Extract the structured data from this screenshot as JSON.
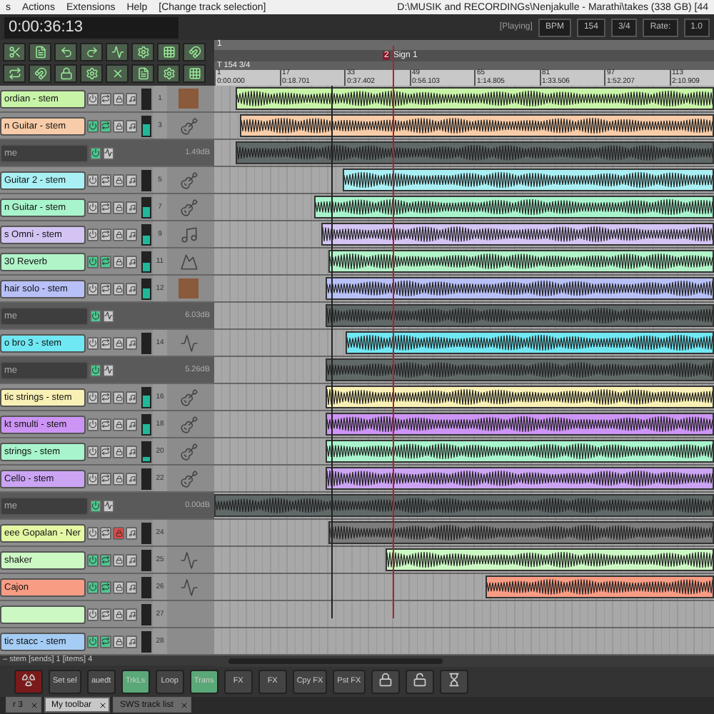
{
  "menu": [
    "s",
    "Actions",
    "Extensions",
    "Help",
    "[Change track selection]"
  ],
  "window": {
    "title": "D:\\MUSIK and RECORDINGs\\Nenjakulle - Marathi\\takes (338 GB) [44"
  },
  "transport": {
    "time": "0:00:36:13",
    "state": "[Playing]",
    "bpm_label": "BPM",
    "bpm": "154",
    "signature": "3/4",
    "rate_label": "Rate:",
    "rate": "1.0"
  },
  "ruler": {
    "marker": "1",
    "region_number": "2",
    "region": "Sign 1",
    "tempo": "T 154 3/4",
    "measures": [
      {
        "bar": "1",
        "time": "0:00.000"
      },
      {
        "bar": "17",
        "time": "0:18.701"
      },
      {
        "bar": "33",
        "time": "0:37.402"
      },
      {
        "bar": "49",
        "time": "0:56.103"
      },
      {
        "bar": "65",
        "time": "1:14.805"
      },
      {
        "bar": "81",
        "time": "1:33.506"
      },
      {
        "bar": "97",
        "time": "1:52.207"
      },
      {
        "bar": "113",
        "time": "2:10.909"
      }
    ]
  },
  "tracks": [
    {
      "kind": "track",
      "name": "ordian - stem",
      "color": "#c8f4a8",
      "number": "1",
      "fx": false,
      "muted": false
    },
    {
      "kind": "track",
      "name": "n Guitar - stem",
      "color": "#f8cca8",
      "number": "3",
      "fx": true,
      "muted": false,
      "level": 0.6
    },
    {
      "kind": "folder",
      "name": "me",
      "volume": "1.49dB"
    },
    {
      "kind": "track",
      "name": "Guitar 2 - stem",
      "color": "#a8f0f4",
      "number": "5",
      "fx": false,
      "muted": false
    },
    {
      "kind": "track",
      "name": "n Guitar - stem",
      "color": "#a8f4cc",
      "number": "7",
      "fx": false,
      "muted": false,
      "level": 0.5
    },
    {
      "kind": "track",
      "name": "s Omni - stem",
      "color": "#d4c4f4",
      "number": "9",
      "fx": false,
      "muted": false,
      "level": 0.4
    },
    {
      "kind": "track",
      "name": "30 Reverb",
      "color": "#b0f4c8",
      "number": "11",
      "fx": true,
      "muted": false,
      "level": 0.4
    },
    {
      "kind": "track",
      "name": "hair solo - stem",
      "color": "#b8c0f8",
      "number": "12",
      "fx": false,
      "muted": false,
      "level": 0.5
    },
    {
      "kind": "folder",
      "name": "me",
      "volume": "6.03dB"
    },
    {
      "kind": "track",
      "name": "o bro 3 - stem",
      "color": "#70e8f4",
      "number": "14",
      "fx": false,
      "muted": false
    },
    {
      "kind": "folder",
      "name": "me",
      "volume": "5.26dB"
    },
    {
      "kind": "track",
      "name": "tic strings - stem",
      "color": "#f8f0b4",
      "number": "16",
      "fx": false,
      "muted": false,
      "level": 0.6
    },
    {
      "kind": "track",
      "name": "kt smulti - stem",
      "color": "#cc94f4",
      "number": "18",
      "fx": false,
      "muted": false,
      "level": 0.5
    },
    {
      "kind": "track",
      "name": "strings - stem",
      "color": "#a8f4cc",
      "number": "20",
      "fx": false,
      "muted": false,
      "level": 0.2
    },
    {
      "kind": "track",
      "name": "Cello - stem",
      "color": "#cca4f4",
      "number": "22",
      "fx": false,
      "muted": false
    },
    {
      "kind": "folder",
      "name": "me",
      "volume": "0.00dB"
    },
    {
      "kind": "track",
      "name": "eee Gopalan - Ner",
      "color": "#e4f8a4",
      "number": "24",
      "fx": false,
      "muted": true
    },
    {
      "kind": "track",
      "name": "shaker",
      "color": "#ccf8c4",
      "number": "25",
      "fx": true,
      "muted": false
    },
    {
      "kind": "track",
      "name": "Cajon",
      "color": "#f89c84",
      "number": "26",
      "fx": true,
      "muted": false
    },
    {
      "kind": "track",
      "color": "#ccf8c4",
      "number": "27",
      "fx": false,
      "muted": false
    },
    {
      "kind": "track",
      "name": "tic stacc - stem",
      "color": "#a4ccf4",
      "number": "28",
      "fx": true,
      "muted": false
    }
  ],
  "status": "– stem [sends] 1 [items] 4",
  "bottom_toolbar": [
    {
      "label": "Set sel",
      "selected": false
    },
    {
      "label": "auedt",
      "selected": false
    },
    {
      "label": "TrkLs",
      "selected": true
    },
    {
      "label": "Loop",
      "selected": false
    },
    {
      "label": "Trans",
      "selected": true
    },
    {
      "label": "FX",
      "selected": false
    },
    {
      "label": "FX",
      "selected": false
    },
    {
      "label": "Cpy FX",
      "selected": false
    },
    {
      "label": "Pst FX",
      "selected": false
    }
  ],
  "tabs": [
    {
      "label": "r 3",
      "selected": false
    },
    {
      "label": "My toolbar",
      "selected": true
    },
    {
      "label": "SWS track list",
      "selected": false
    }
  ]
}
